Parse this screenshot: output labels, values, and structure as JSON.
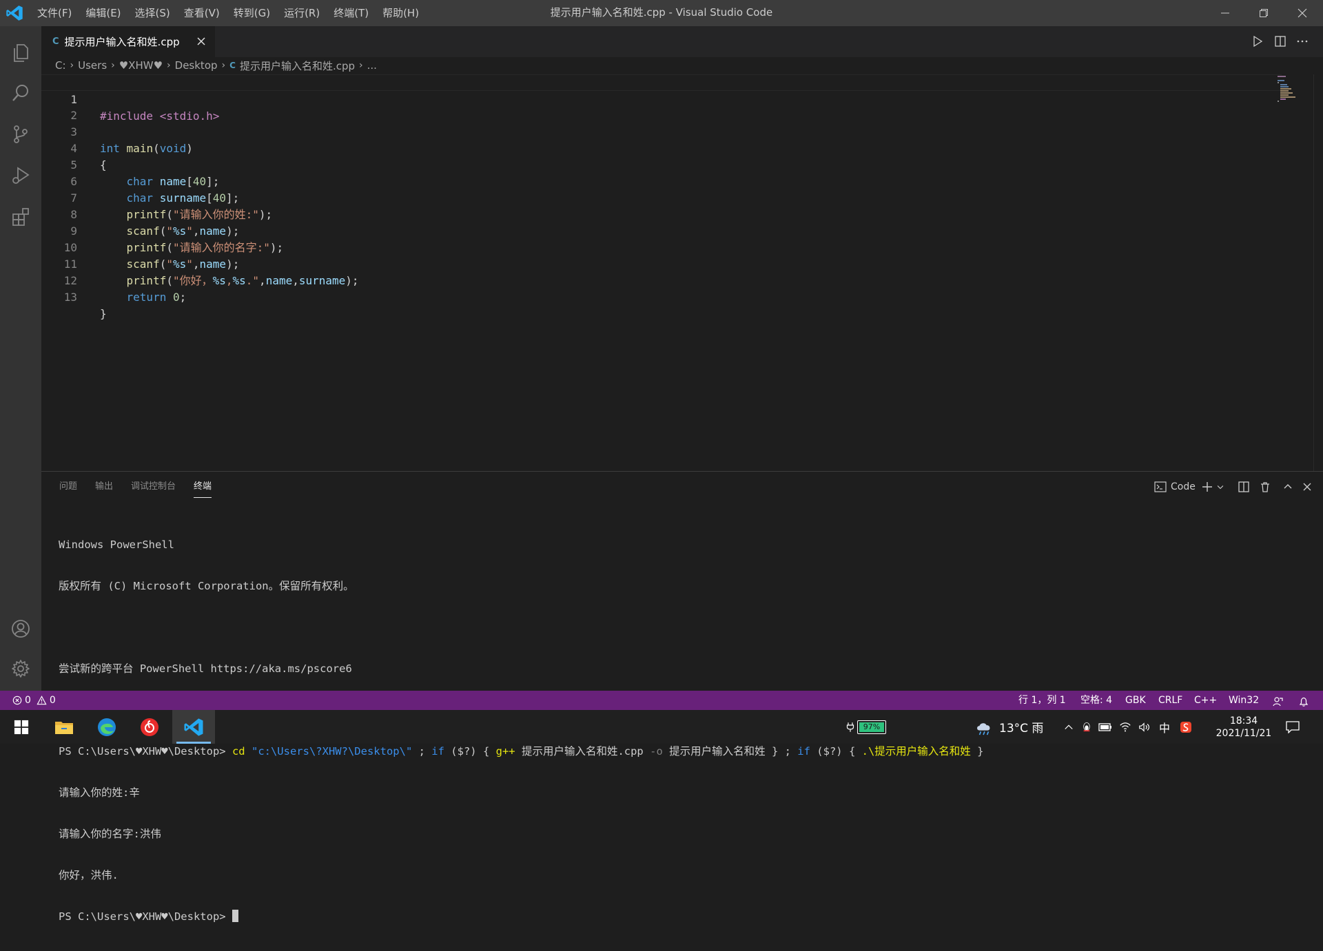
{
  "app": {
    "window_title": "提示用户输入名和姓.cpp - Visual Studio Code",
    "menu": [
      "文件(F)",
      "编辑(E)",
      "选择(S)",
      "查看(V)",
      "转到(G)",
      "运行(R)",
      "终端(T)",
      "帮助(H)"
    ]
  },
  "activity_bar": [
    "explorer-icon",
    "search-icon",
    "source-control-icon",
    "run-debug-icon",
    "extensions-icon",
    "account-icon",
    "settings-gear-icon"
  ],
  "tab": {
    "icon": "C",
    "label": "提示用户输入名和姓.cpp"
  },
  "breadcrumb": {
    "items": [
      "C:",
      "Users",
      "♥XHW♥",
      "Desktop"
    ],
    "icon": "C",
    "file": "提示用户输入名和姓.cpp",
    "more": "..."
  },
  "editor": {
    "lines": [
      "#include <stdio.h>",
      "",
      "int main(void)",
      "{",
      "    char name[40];",
      "    char surname[40];",
      "    printf(\"请输入你的姓:\");",
      "    scanf(\"%s\",name);",
      "    printf(\"请输入你的名字:\");",
      "    scanf(\"%s\",name);",
      "    printf(\"你好，%s,%s.\",name,surname);",
      "    return 0;",
      "}"
    ],
    "line_numbers": [
      "1",
      "2",
      "3",
      "4",
      "5",
      "6",
      "7",
      "8",
      "9",
      "10",
      "11",
      "12",
      "13"
    ]
  },
  "panel": {
    "tabs": [
      "问题",
      "输出",
      "调试控制台",
      "终端"
    ],
    "active_tab": "终端",
    "terminal_name": "Code",
    "terminal": {
      "l1": "Windows PowerShell",
      "l2": "版权所有 (C) Microsoft Corporation。保留所有权利。",
      "l3": "尝试新的跨平台 PowerShell https://aka.ms/pscore6",
      "prompt": "PS C:\\Users\\♥XHW♥\\Desktop> ",
      "cmd_cd": "cd",
      "cmd_path": "\"c:\\Users\\?XHW?\\Desktop\\\"",
      "cmd_semi1": " ; ",
      "cmd_if1": "if",
      "cmd_cond1": " ($?) { ",
      "cmd_gpp": "g++",
      "cmd_src": " 提示用户输入名和姓.cpp ",
      "cmd_o": "-o",
      "cmd_out": " 提示用户输入名和姓 } ; ",
      "cmd_if2": "if",
      "cmd_cond2": " ($?) { ",
      "cmd_run": ".\\提示用户输入名和姓",
      "cmd_end": " }",
      "out1": "请输入你的姓:辛",
      "out2": "请输入你的名字:洪伟",
      "out3": "你好，洪伟.",
      "prompt2": "PS C:\\Users\\♥XHW♥\\Desktop> "
    }
  },
  "status": {
    "errors": "0",
    "warnings": "0",
    "position": "行 1，列 1",
    "spaces": "空格: 4",
    "encoding": "GBK",
    "eol": "CRLF",
    "language": "C++",
    "platform": "Win32"
  },
  "taskbar": {
    "apps": [
      "windows-start-icon",
      "file-explorer-icon",
      "edge-icon",
      "netease-music-icon",
      "vscode-icon"
    ],
    "battery": "97%",
    "weather": "13°C 雨",
    "ime": "中",
    "time": "18:34",
    "date": "2021/11/21"
  },
  "colors": {
    "status_bar": "#68217a",
    "accent": "#007acc"
  }
}
